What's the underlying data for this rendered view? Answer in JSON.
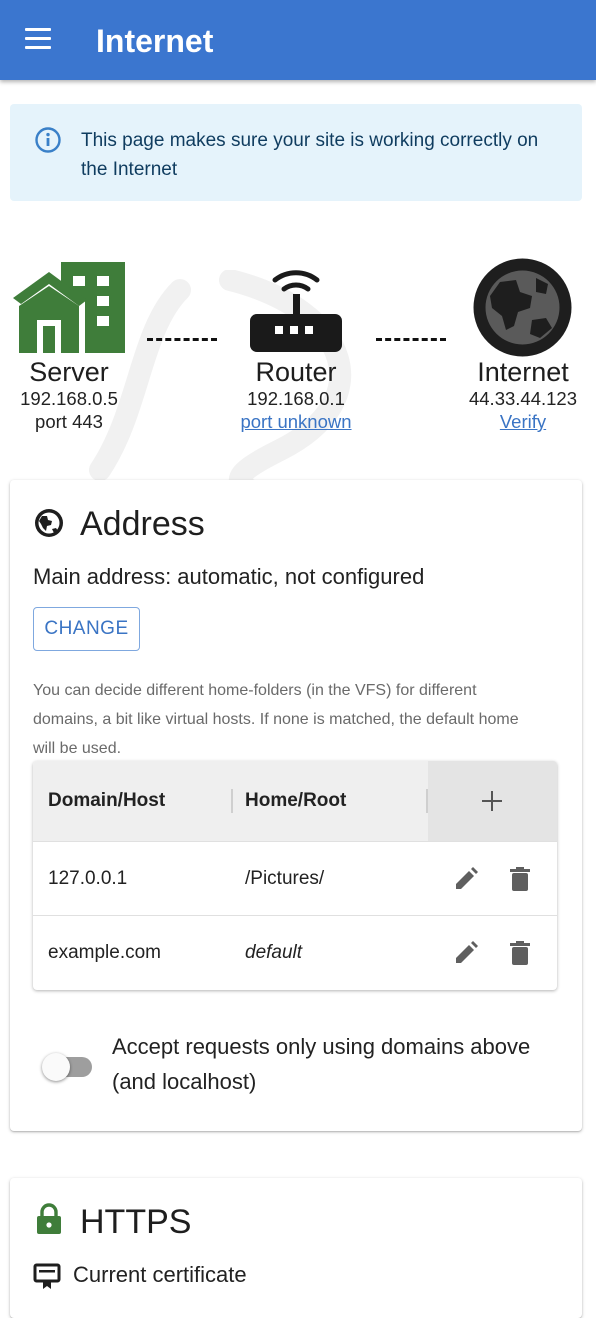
{
  "appbar": {
    "title": "Internet",
    "menu_icon": "menu-icon"
  },
  "info": {
    "icon": "info-icon",
    "text": "This page makes sure your site is working correctly on the Internet"
  },
  "network": {
    "server": {
      "label": "Server",
      "ip": "192.168.0.5",
      "port": "port 443"
    },
    "router": {
      "label": "Router",
      "ip": "192.168.0.1",
      "port_link": "port unknown"
    },
    "internet": {
      "label": "Internet",
      "ip": "44.33.44.123",
      "verify_link": "Verify"
    }
  },
  "address": {
    "title": "Address",
    "main_address": "Main address: automatic, not configured",
    "change_label": "CHANGE",
    "help": "You can decide different home-folders (in the VFS) for different domains, a bit like virtual hosts. If none is matched, the default home will be used.",
    "columns": [
      "Domain/Host",
      "Home/Root"
    ],
    "add_symbol": "+",
    "rows": [
      {
        "domain": "127.0.0.1",
        "root": "/Pictures/"
      },
      {
        "domain": "example.com",
        "root": "default"
      }
    ],
    "toggle_label": "Accept requests only using domains above (and localhost)",
    "toggle_on": false
  },
  "https": {
    "title": "HTTPS",
    "current_certificate": "Current certificate"
  },
  "colors": {
    "appbar": "#3b76cf",
    "info_bg": "#e5f3fb",
    "server_green": "#3f7d3a",
    "link": "#3a74c4"
  }
}
